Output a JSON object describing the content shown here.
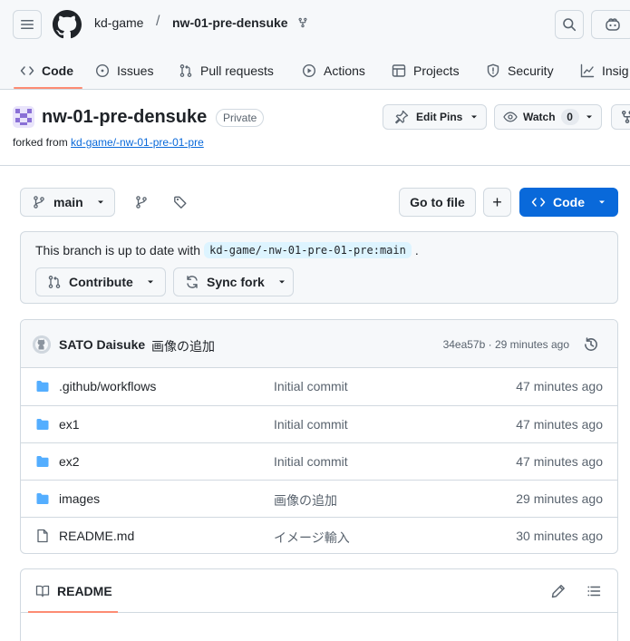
{
  "header": {
    "owner": "kd-game",
    "separator": "/",
    "repo": "nw-01-pre-densuke"
  },
  "tabs": [
    {
      "label": "Code",
      "icon": "code-icon",
      "active": true
    },
    {
      "label": "Issues",
      "icon": "issue-icon"
    },
    {
      "label": "Pull requests",
      "icon": "pull-request-icon"
    },
    {
      "label": "Actions",
      "icon": "play-icon"
    },
    {
      "label": "Projects",
      "icon": "table-icon"
    },
    {
      "label": "Security",
      "icon": "shield-icon"
    },
    {
      "label": "Insig",
      "icon": "graph-icon"
    }
  ],
  "repo": {
    "name": "nw-01-pre-densuke",
    "visibility": "Private",
    "forked_prefix": "forked from",
    "forked_source": "kd-game/-nw-01-pre-01-pre"
  },
  "repo_actions": {
    "edit_pins": "Edit Pins",
    "watch": "Watch",
    "watch_count": "0"
  },
  "branch_bar": {
    "branch": "main",
    "go_to_file": "Go to file",
    "plus": "+",
    "code": "Code"
  },
  "fork_status": {
    "text": "This branch is up to date with",
    "ref": "kd-game/-nw-01-pre-01-pre:main",
    "period": ".",
    "contribute": "Contribute",
    "sync_fork": "Sync fork"
  },
  "latest_commit": {
    "author": "SATO Daisuke",
    "message": "画像の追加",
    "meta": "34ea57b · 29 minutes ago"
  },
  "files": [
    {
      "name": ".github/workflows",
      "type": "folder",
      "message": "Initial commit",
      "age": "47 minutes ago"
    },
    {
      "name": "ex1",
      "type": "folder",
      "message": "Initial commit",
      "age": "47 minutes ago"
    },
    {
      "name": "ex2",
      "type": "folder",
      "message": "Initial commit",
      "age": "47 minutes ago"
    },
    {
      "name": "images",
      "type": "folder",
      "message": "画像の追加",
      "age": "29 minutes ago"
    },
    {
      "name": "README.md",
      "type": "file",
      "message": "イメージ輸入",
      "age": "30 minutes ago"
    }
  ],
  "readme": {
    "title": "README"
  },
  "colors": {
    "accent": "#0969da",
    "tab_underline": "#fd8c73",
    "folder": "#54aeff",
    "border": "#d1d9e0",
    "muted": "#59636e"
  }
}
